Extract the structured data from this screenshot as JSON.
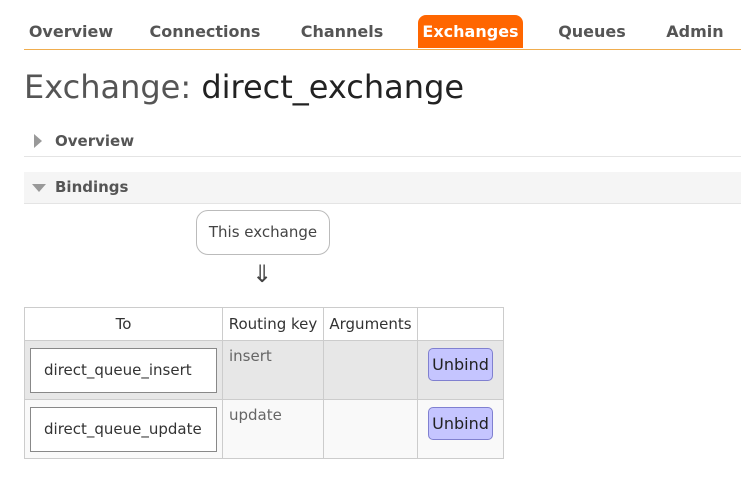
{
  "nav": {
    "tabs": [
      {
        "label": "Overview"
      },
      {
        "label": "Connections"
      },
      {
        "label": "Channels"
      },
      {
        "label": "Exchanges"
      },
      {
        "label": "Queues"
      },
      {
        "label": "Admin"
      }
    ],
    "active_tab": "Exchanges",
    "accent_color": "#ff6600"
  },
  "page": {
    "heading_prefix": "Exchange:",
    "heading_name": "direct_exchange"
  },
  "sections": {
    "overview": {
      "label": "Overview",
      "expanded": false
    },
    "bindings": {
      "label": "Bindings",
      "expanded": true
    }
  },
  "bindings": {
    "source_label": "This exchange",
    "arrow": "⇓",
    "columns": [
      "To",
      "Routing key",
      "Arguments",
      ""
    ],
    "rows": [
      {
        "to": "direct_queue_insert",
        "routing_key": "insert",
        "arguments": "",
        "action": "Unbind"
      },
      {
        "to": "direct_queue_update",
        "routing_key": "update",
        "arguments": "",
        "action": "Unbind"
      }
    ]
  }
}
